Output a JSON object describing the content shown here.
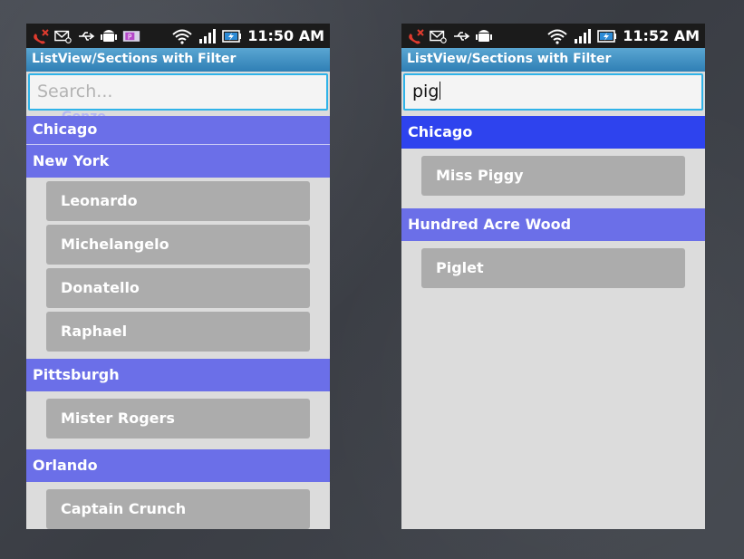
{
  "left": {
    "status_time": "11:50 AM",
    "title": "ListView/Sections with Filter",
    "search": {
      "value": "",
      "placeholder": "Search..."
    },
    "ghost_item": "Gonzo",
    "pinned_header": "Chicago",
    "sections": [
      {
        "header": "New York",
        "items": [
          "Leonardo",
          "Michelangelo",
          "Donatello",
          "Raphael"
        ]
      },
      {
        "header": "Pittsburgh",
        "items": [
          "Mister Rogers"
        ]
      },
      {
        "header": "Orlando",
        "items": [
          "Captain Crunch"
        ]
      }
    ]
  },
  "right": {
    "status_time": "11:52 AM",
    "title": "ListView/Sections with Filter",
    "search": {
      "value": "pig",
      "placeholder": "Search..."
    },
    "sections": [
      {
        "header": "Chicago",
        "items": [
          "Miss Piggy"
        ]
      },
      {
        "header": "Hundred Acre Wood",
        "items": [
          "Piglet"
        ]
      }
    ]
  },
  "colors": {
    "header_bg": "#6b6fe8",
    "header_active_bg": "#2e43ee",
    "item_bg": "#acacac",
    "search_border": "#30b3e8",
    "titlebar_bg": "#3f8fc4"
  },
  "status_icons": [
    "missed-call-icon",
    "voicemail-icon",
    "usb-icon",
    "android-debug-icon",
    "parking-icon",
    "wifi-icon",
    "signal-icon",
    "battery-charging-icon"
  ]
}
